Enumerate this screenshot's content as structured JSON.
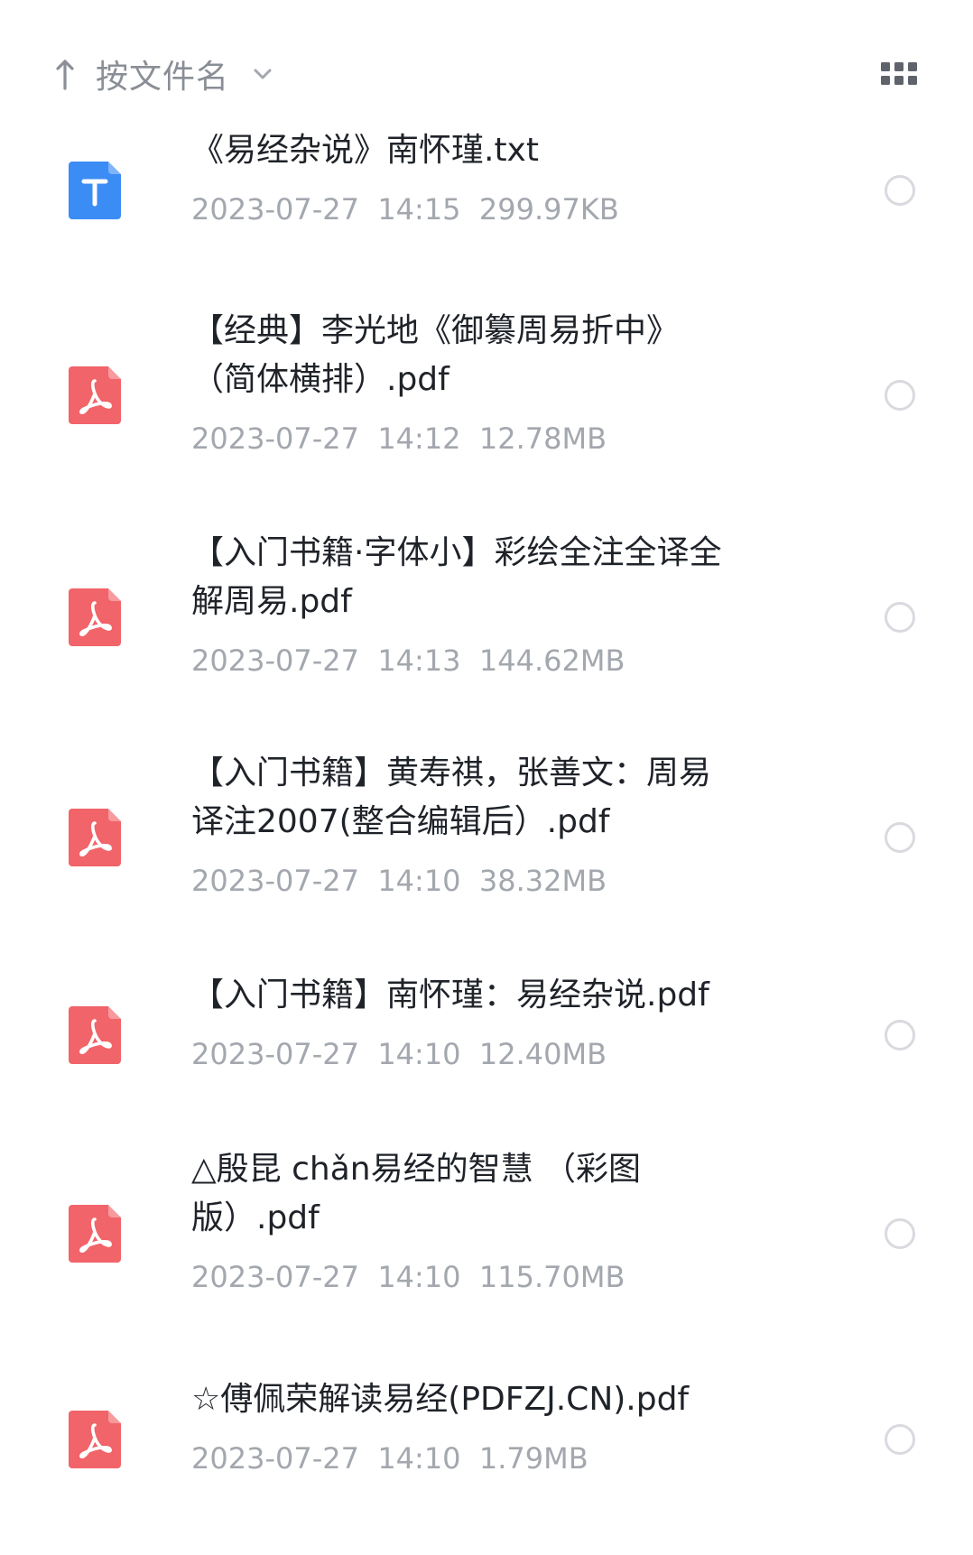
{
  "sort": {
    "label": "按文件名"
  },
  "icons": {
    "sort_arrow": "arrow-up-icon",
    "chevron": "chevron-down-icon",
    "view_toggle": "grid-view-icon",
    "txt": "txt-file-icon",
    "pdf": "pdf-file-icon"
  },
  "colors": {
    "txt_icon": "#3b8cf5",
    "pdf_icon": "#f16469",
    "name_text": "#1f2329",
    "meta_text": "#a3a7ae",
    "sort_text": "#8a8e96",
    "radio_border": "#d8dadf"
  },
  "files": [
    {
      "type": "txt",
      "name": "《易经杂说》南怀瑾.txt",
      "date": "2023-07-27",
      "time": "14:15",
      "size": "299.97KB",
      "selected": false
    },
    {
      "type": "pdf",
      "name": "【经典】李光地《御纂周易折中》（简体横排）.pdf",
      "date": "2023-07-27",
      "time": "14:12",
      "size": "12.78MB",
      "selected": false
    },
    {
      "type": "pdf",
      "name": "【入门书籍·字体小】彩绘全注全译全解周易.pdf",
      "date": "2023-07-27",
      "time": "14:13",
      "size": "144.62MB",
      "selected": false
    },
    {
      "type": "pdf",
      "name": "【入门书籍】黄寿祺，张善文：周易译注2007(整合编辑后）.pdf",
      "date": "2023-07-27",
      "time": "14:10",
      "size": "38.32MB",
      "selected": false
    },
    {
      "type": "pdf",
      "name": "【入门书籍】南怀瑾：易经杂说.pdf",
      "date": "2023-07-27",
      "time": "14:10",
      "size": "12.40MB",
      "selected": false
    },
    {
      "type": "pdf",
      "name": "△殷昆 chǎn易经的智慧 （彩图版）.pdf",
      "date": "2023-07-27",
      "time": "14:10",
      "size": "115.70MB",
      "selected": false
    },
    {
      "type": "pdf",
      "name": "☆傅佩荣解读易经(PDFZJ.CN).pdf",
      "date": "2023-07-27",
      "time": "14:10",
      "size": "1.79MB",
      "selected": false
    }
  ]
}
